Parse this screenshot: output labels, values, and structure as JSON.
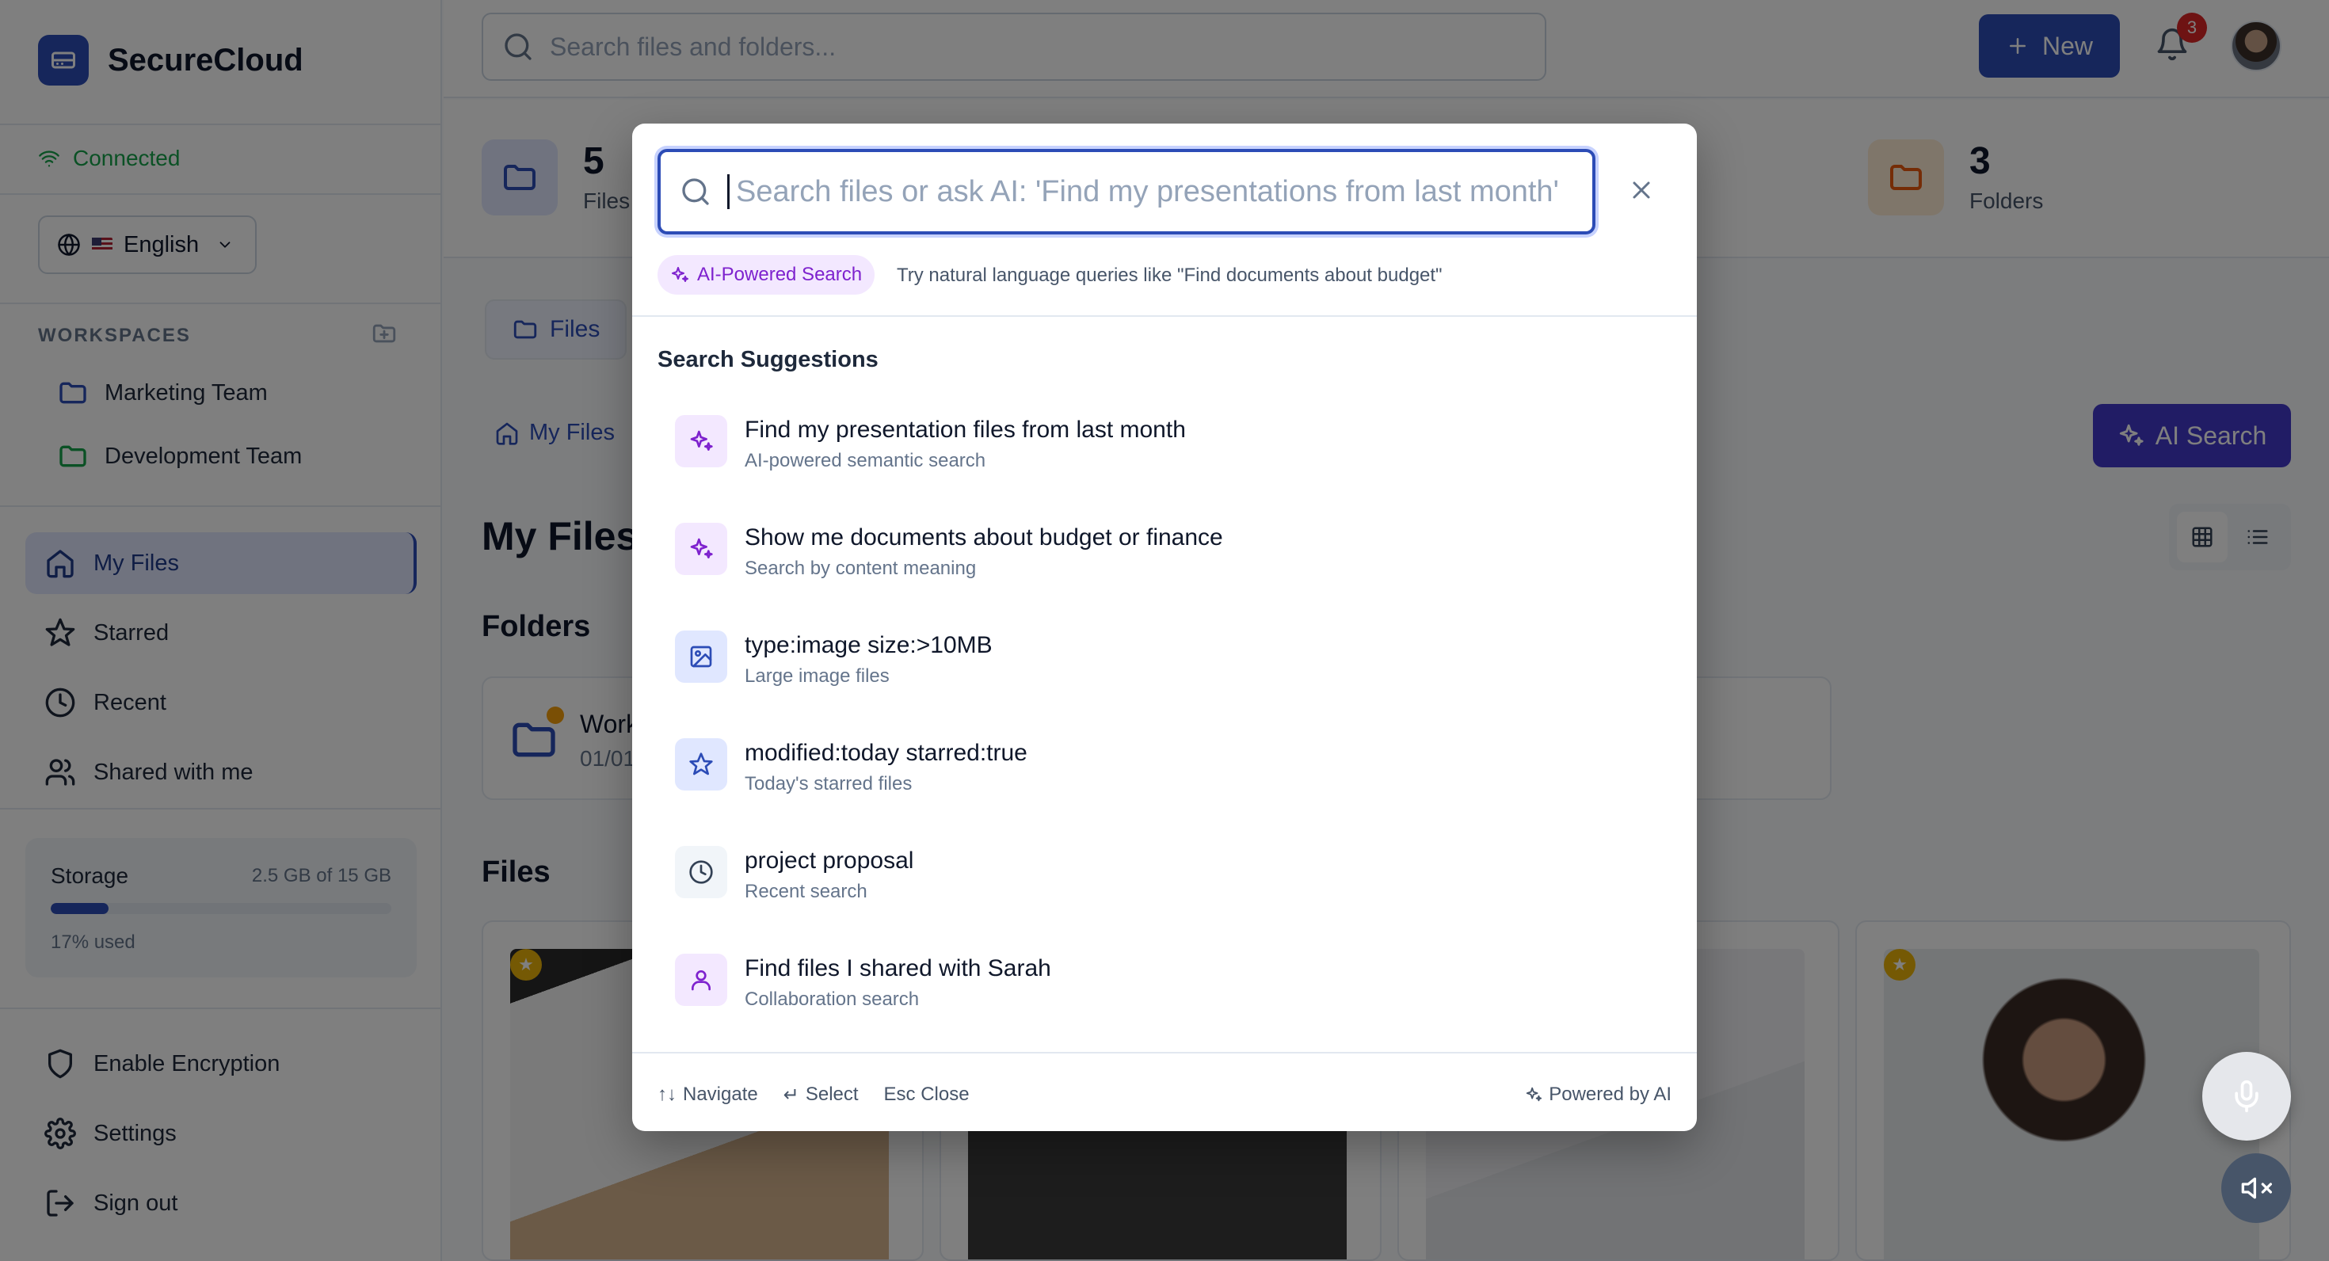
{
  "app": {
    "name": "SecureCloud"
  },
  "sidebar": {
    "status": "Connected",
    "language": "English",
    "workspaces_title": "WORKSPACES",
    "workspaces": [
      {
        "label": "Marketing Team",
        "color": "#2c4cb6"
      },
      {
        "label": "Development Team",
        "color": "#16a34a"
      }
    ],
    "nav": [
      {
        "label": "My Files",
        "icon": "home-icon",
        "active": true
      },
      {
        "label": "Starred",
        "icon": "star-icon"
      },
      {
        "label": "Recent",
        "icon": "clock-icon"
      },
      {
        "label": "Shared with me",
        "icon": "users-icon"
      }
    ],
    "storage": {
      "label": "Storage",
      "value": "2.5 GB of 15 GB",
      "used_label": "17% used",
      "used_fraction": 0.17
    },
    "bottom": [
      {
        "label": "Enable Encryption",
        "icon": "shield-icon"
      },
      {
        "label": "Settings",
        "icon": "gear-icon"
      },
      {
        "label": "Sign out",
        "icon": "logout-icon"
      }
    ]
  },
  "header": {
    "search_placeholder": "Search files and folders...",
    "new_label": "New",
    "notifications": "3"
  },
  "stats": [
    {
      "value": "5",
      "label": "Files"
    },
    {
      "value": "3",
      "label": "Folders"
    }
  ],
  "main": {
    "tab": "Files",
    "breadcrumb": "My Files",
    "ai_search_label": "AI Search",
    "title": "My Files",
    "folders_title": "Folders",
    "folder": {
      "name": "Work",
      "date": "01/01"
    },
    "files_title": "Files"
  },
  "modal": {
    "placeholder": "Search files or ask AI: 'Find my presentations from last month'",
    "ai_pill": "AI-Powered Search",
    "hint": "Try natural language queries like \"Find documents about budget\"",
    "suggestions_title": "Search Suggestions",
    "suggestions": [
      {
        "title": "Find my presentation files from last month",
        "subtitle": "AI-powered semantic search",
        "icon": "sparkle-icon"
      },
      {
        "title": "Show me documents about budget or finance",
        "subtitle": "Search by content meaning",
        "icon": "sparkle-icon"
      },
      {
        "title": "type:image size:>10MB",
        "subtitle": "Large image files",
        "icon": "image-icon"
      },
      {
        "title": "modified:today starred:true",
        "subtitle": "Today's starred files",
        "icon": "star-icon"
      },
      {
        "title": "project proposal",
        "subtitle": "Recent search",
        "icon": "clock-icon"
      },
      {
        "title": "Find files I shared with Sarah",
        "subtitle": "Collaboration search",
        "icon": "user-icon"
      }
    ],
    "footer": {
      "navigate": "Navigate",
      "select": "Select",
      "close": "Esc Close",
      "powered": "Powered by AI"
    }
  },
  "colors": {
    "primary": "#2c4cb6",
    "ai": "#7e22ce",
    "success": "#16a34a"
  }
}
